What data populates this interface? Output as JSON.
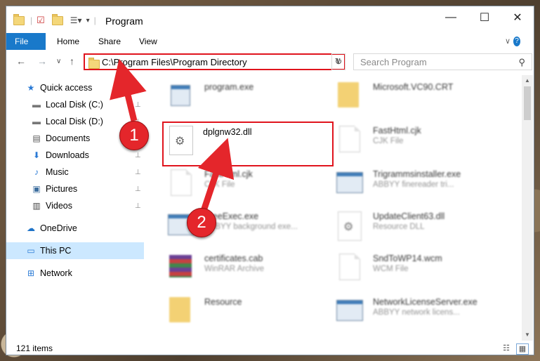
{
  "window": {
    "title": "Program",
    "minimize": "—",
    "maximize": "☐",
    "close": "✕"
  },
  "ribbon": {
    "tabs": [
      "File",
      "Home",
      "Share",
      "View"
    ],
    "help": "?",
    "expand": "∨"
  },
  "nav": {
    "back": "←",
    "forward": "→",
    "recent": "∨",
    "up": "↑",
    "address": "C:\\Program Files\\Program Directory",
    "address_chevron": "∨",
    "refresh": "↻",
    "search_placeholder": "Search Program",
    "search_icon": "⚲"
  },
  "sidebar": {
    "items": [
      {
        "label": "Quick access",
        "icon": "★",
        "icon_name": "star-icon"
      },
      {
        "label": "Local Disk (C:)",
        "icon": "▬",
        "icon_name": "disk-icon"
      },
      {
        "label": "Local Disk (D:)",
        "icon": "▬",
        "icon_name": "disk-icon"
      },
      {
        "label": "Documents",
        "icon": "▤",
        "icon_name": "documents-icon"
      },
      {
        "label": "Downloads",
        "icon": "⬇",
        "icon_name": "downloads-icon"
      },
      {
        "label": "Music",
        "icon": "♪",
        "icon_name": "music-icon"
      },
      {
        "label": "Pictures",
        "icon": "▣",
        "icon_name": "pictures-icon"
      },
      {
        "label": "Videos",
        "icon": "▥",
        "icon_name": "videos-icon"
      },
      {
        "label": "OneDrive",
        "icon": "☁",
        "icon_name": "cloud-icon"
      },
      {
        "label": "This PC",
        "icon": "▭",
        "icon_name": "computer-icon"
      },
      {
        "label": "Network",
        "icon": "⊞",
        "icon_name": "network-icon"
      }
    ],
    "pin": "📌"
  },
  "files": [
    {
      "name": "program.exe",
      "type": ""
    },
    {
      "name": "Microsoft.VC90.CRT",
      "type": ""
    },
    {
      "name": "dplgnw32.dll",
      "type": ""
    },
    {
      "name": "FastHtml.cjk",
      "type": "CJK File"
    },
    {
      "name": "FastHtml.cjk",
      "type": "CJK File"
    },
    {
      "name": "Trigrammsinstaller.exe",
      "type": "ABBYY finereader tri..."
    },
    {
      "name": "FreeExec.exe",
      "type": "ABBYY background exe..."
    },
    {
      "name": "UpdateClient63.dll",
      "type": "Resource DLL"
    },
    {
      "name": "certificates.cab",
      "type": "WinRAR Archive"
    },
    {
      "name": "SndToWP14.wcm",
      "type": "WCM File"
    },
    {
      "name": "Resource",
      "type": ""
    },
    {
      "name": "NetworkLicenseServer.exe",
      "type": "ABBYY network licens..."
    }
  ],
  "callouts": [
    "1",
    "2"
  ],
  "status": {
    "count": "121 items",
    "view_details": "☷",
    "view_icons": "▦"
  },
  "colors": {
    "accent": "#1979ca",
    "highlight": "#e0141d",
    "selected": "#cce8ff"
  }
}
